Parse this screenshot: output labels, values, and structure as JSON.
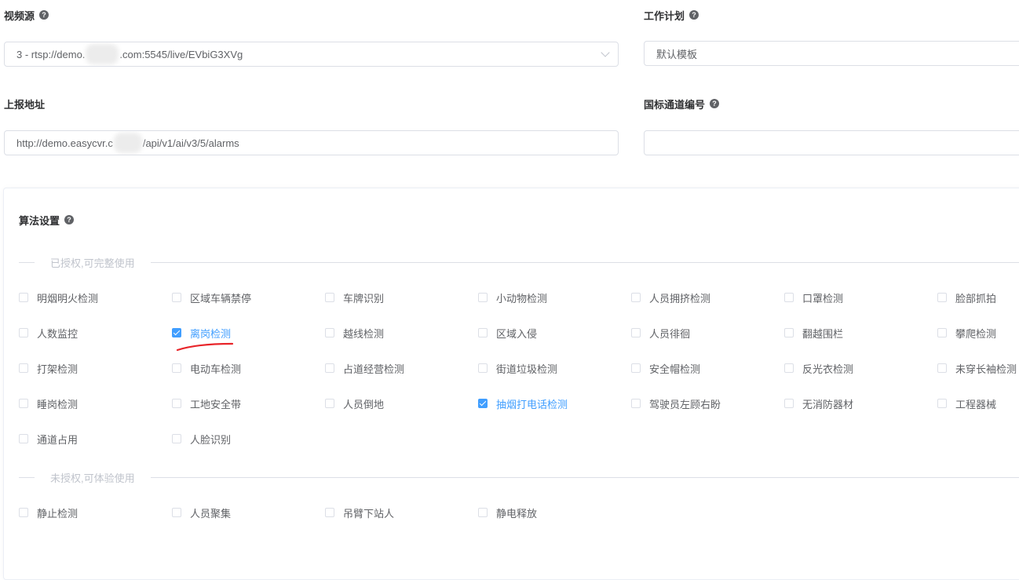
{
  "form": {
    "video_source": {
      "label": "视频源",
      "value_prefix": "3 - rtsp://demo.",
      "value_suffix": ".com:5545/live/EVbiG3XVg"
    },
    "work_plan": {
      "label": "工作计划",
      "value": "默认模板"
    },
    "report_url": {
      "label": "上报地址",
      "value_prefix": "http://demo.easycvr.c",
      "value_suffix": "/api/v1/ai/v3/5/alarms"
    },
    "gb_channel": {
      "label": "国标通道编号",
      "value": ""
    }
  },
  "algorithm": {
    "title": "算法设置",
    "authorized_title": "已授权,可完整使用",
    "unauthorized_title": "未授权,可体验使用",
    "authorized": [
      {
        "label": "明烟明火检测",
        "checked": false
      },
      {
        "label": "区域车辆禁停",
        "checked": false
      },
      {
        "label": "车牌识别",
        "checked": false
      },
      {
        "label": "小动物检测",
        "checked": false
      },
      {
        "label": "人员拥挤检测",
        "checked": false
      },
      {
        "label": "口罩检测",
        "checked": false
      },
      {
        "label": "脸部抓拍",
        "checked": false
      },
      {
        "label": "人数监控",
        "checked": false
      },
      {
        "label": "离岗检测",
        "checked": true
      },
      {
        "label": "越线检测",
        "checked": false
      },
      {
        "label": "区域入侵",
        "checked": false
      },
      {
        "label": "人员徘徊",
        "checked": false
      },
      {
        "label": "翻越围栏",
        "checked": false
      },
      {
        "label": "攀爬检测",
        "checked": false
      },
      {
        "label": "打架检测",
        "checked": false
      },
      {
        "label": "电动车检测",
        "checked": false
      },
      {
        "label": "占道经营检测",
        "checked": false
      },
      {
        "label": "街道垃圾检测",
        "checked": false
      },
      {
        "label": "安全帽检测",
        "checked": false
      },
      {
        "label": "反光衣检测",
        "checked": false
      },
      {
        "label": "未穿长袖检测",
        "checked": false
      },
      {
        "label": "睡岗检测",
        "checked": false
      },
      {
        "label": "工地安全带",
        "checked": false
      },
      {
        "label": "人员倒地",
        "checked": false
      },
      {
        "label": "抽烟打电话检测",
        "checked": true
      },
      {
        "label": "驾驶员左顾右盼",
        "checked": false
      },
      {
        "label": "无消防器材",
        "checked": false
      },
      {
        "label": "工程器械",
        "checked": false
      },
      {
        "label": "通道占用",
        "checked": false
      },
      {
        "label": "人脸识别",
        "checked": false
      }
    ],
    "unauthorized": [
      {
        "label": "静止检测",
        "checked": false
      },
      {
        "label": "人员聚集",
        "checked": false
      },
      {
        "label": "吊臂下站人",
        "checked": false
      },
      {
        "label": "静电释放",
        "checked": false
      }
    ]
  },
  "colors": {
    "accent": "#409eff",
    "annotation": "#e8252a"
  },
  "icons": {
    "help": "question-circle-icon",
    "select_arrow": "chevron-down-icon"
  }
}
